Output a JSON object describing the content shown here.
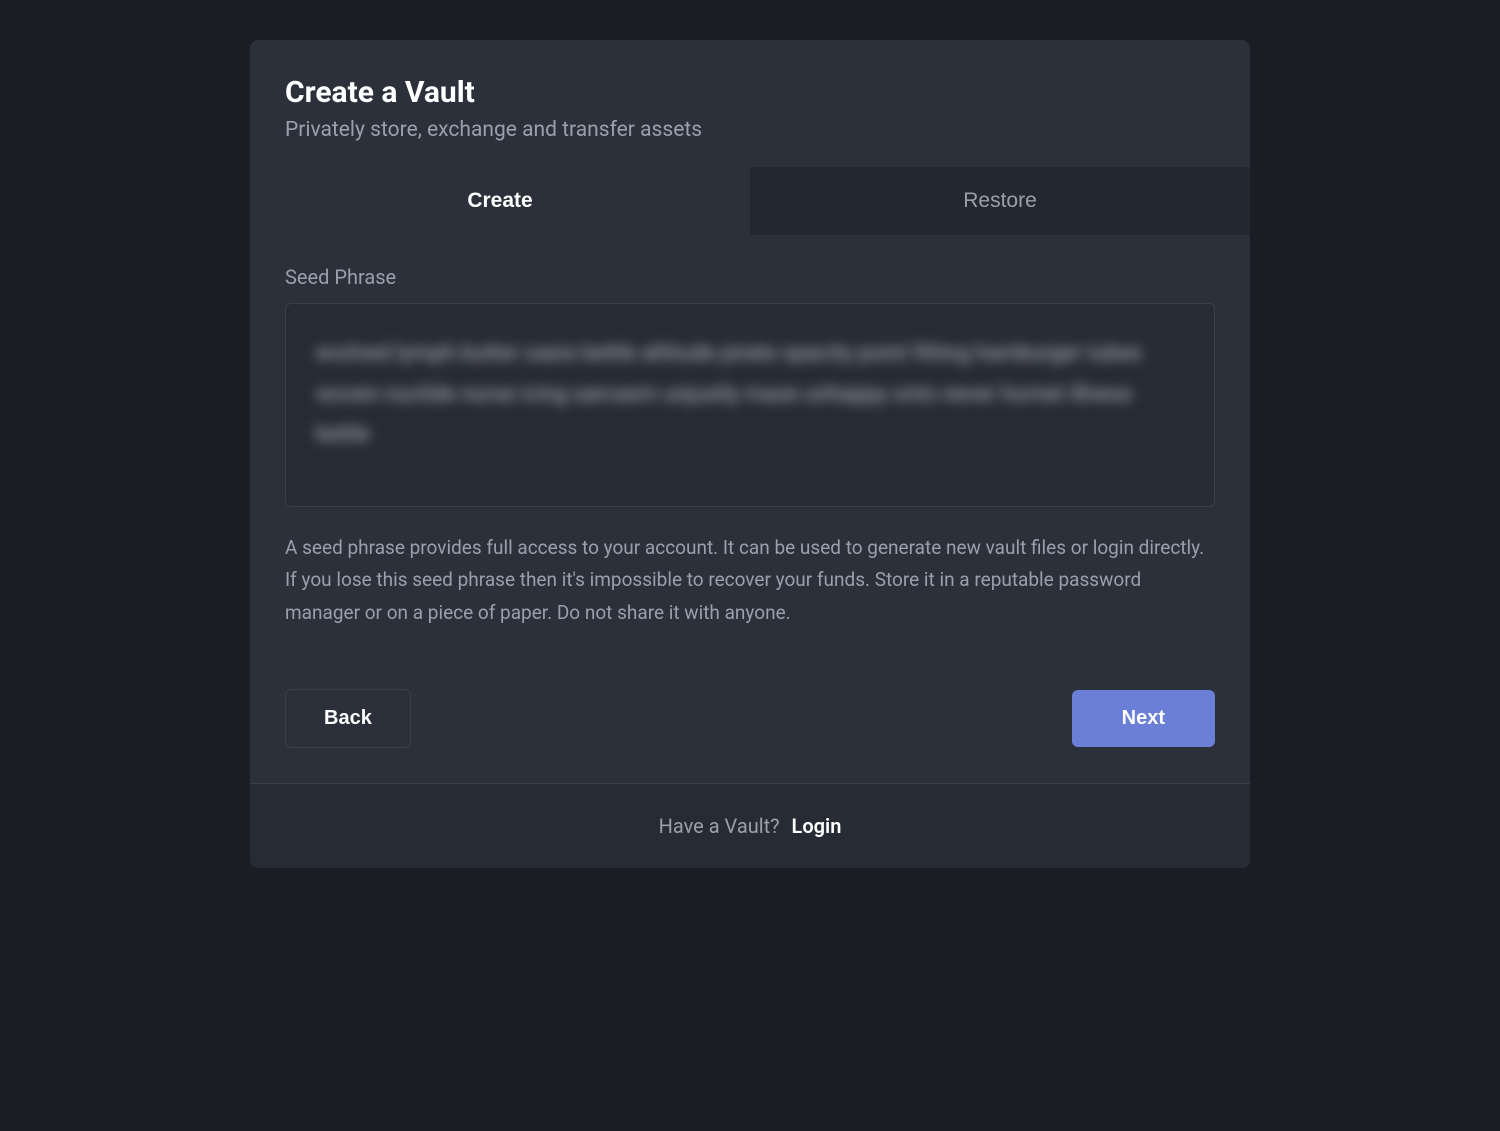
{
  "header": {
    "title": "Create a Vault",
    "subtitle": "Privately store, exchange and transfer assets"
  },
  "tabs": {
    "create": "Create",
    "restore": "Restore"
  },
  "seed": {
    "label": "Seed Phrase",
    "phrase": "evolved lymph butter oasis kettle altitude pirate opacity point fitting hamburger tubes woven nuclide nurse icing sarcasm unjustly maze unhappy onto never hornet illness kettle",
    "helper": "A seed phrase provides full access to your account. It can be used to generate new vault files or login directly. If you lose this seed phrase then it's impossible to recover your funds. Store it in a reputable password manager or on a piece of paper. Do not share it with anyone."
  },
  "buttons": {
    "back": "Back",
    "next": "Next"
  },
  "footer": {
    "prompt": "Have a Vault?",
    "link": "Login"
  }
}
